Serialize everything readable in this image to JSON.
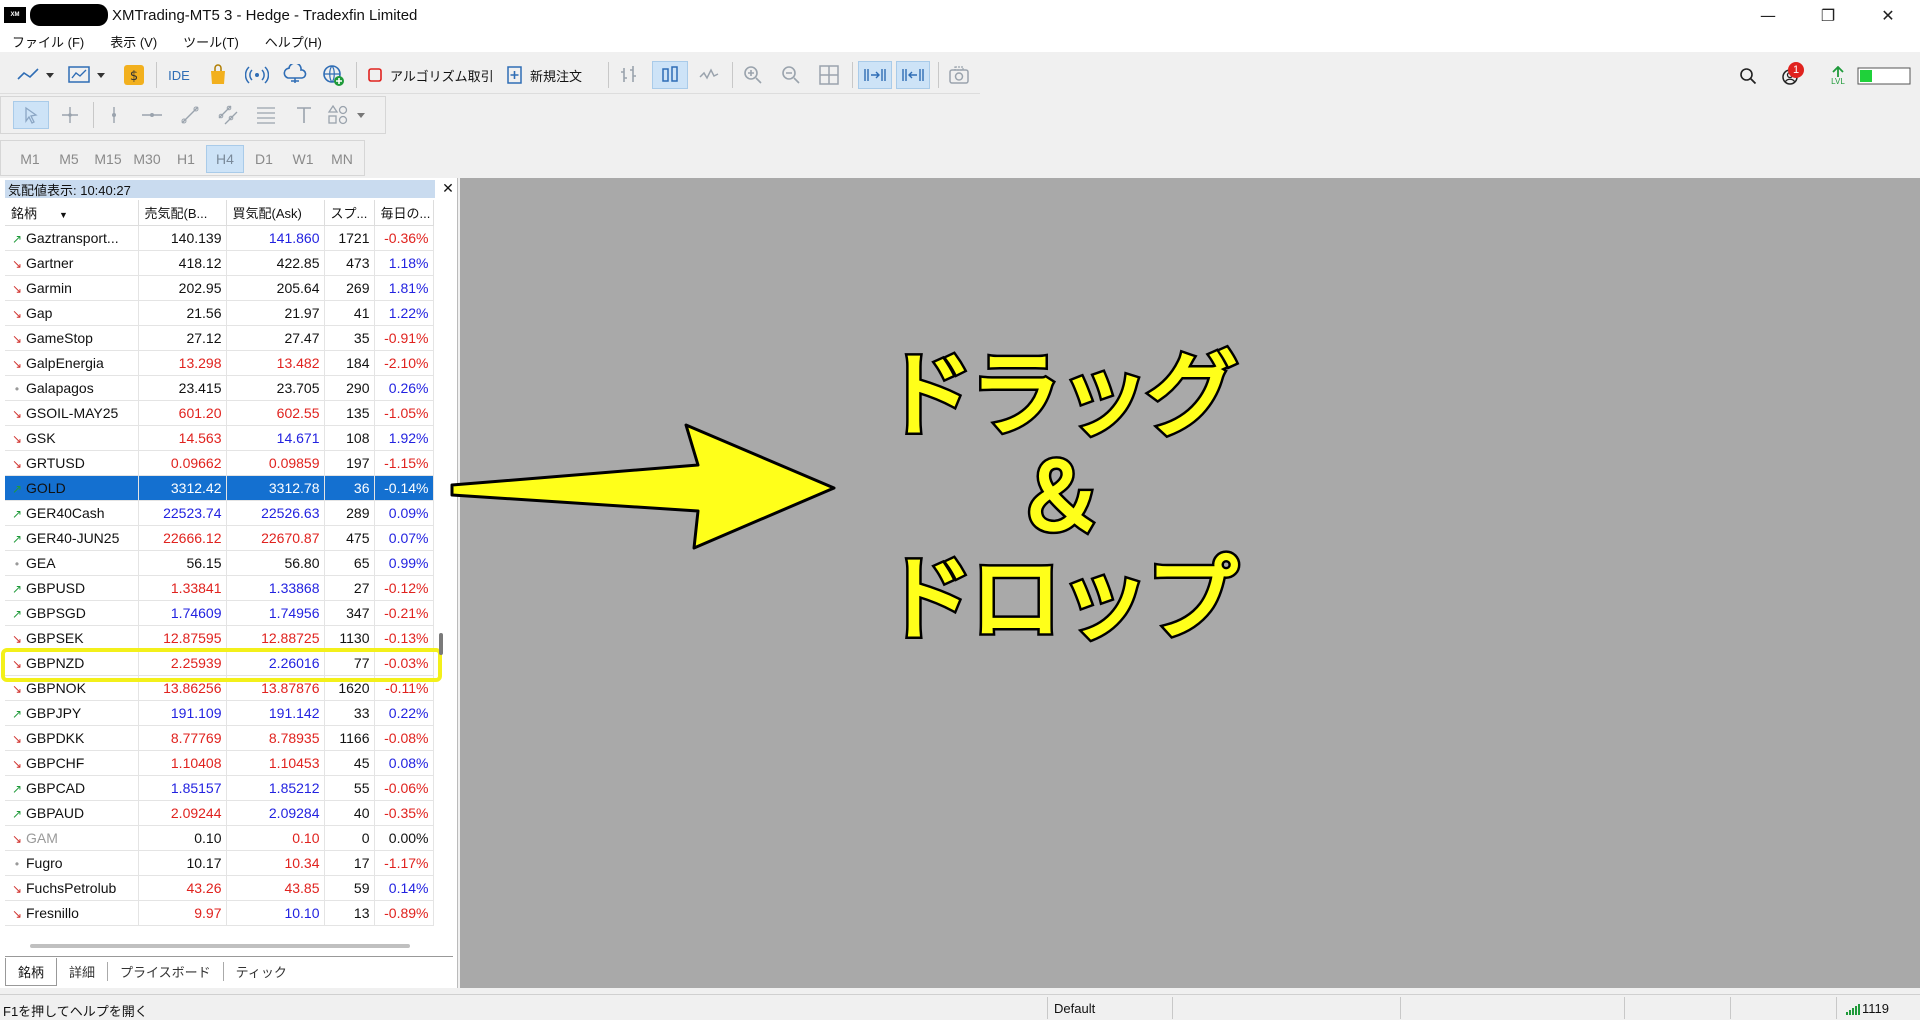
{
  "window": {
    "title": "XMTrading-MT5 3 - Hedge - Tradexfin Limited",
    "logo_text": "XM"
  },
  "menu": [
    "ファイル (F)",
    "表示 (V)",
    "ツール(T)",
    "ヘルプ(H)"
  ],
  "toolbar": {
    "ide_label": "IDE",
    "algo_label": "アルゴリズム取引",
    "new_order_label": "新規注文",
    "notification_count": "1",
    "level_label": "LVL"
  },
  "timeframes": [
    "M1",
    "M5",
    "M15",
    "M30",
    "H1",
    "H4",
    "D1",
    "W1",
    "MN"
  ],
  "active_timeframe": "H4",
  "market_watch": {
    "title": "気配値表示: 10:40:27",
    "columns": [
      "銘柄",
      "売気配(B...",
      "買気配(Ask)",
      "スプ...",
      "毎日の..."
    ],
    "rows": [
      {
        "symbol": "Gaztransport...",
        "dir": "up",
        "bid": "140.139",
        "ask": "141.860",
        "spread": "1721",
        "change": "-0.36%",
        "bid_color": "black",
        "ask_color": "blue",
        "change_color": "red"
      },
      {
        "symbol": "Gartner",
        "dir": "down",
        "bid": "418.12",
        "ask": "422.85",
        "spread": "473",
        "change": "1.18%",
        "bid_color": "black",
        "ask_color": "black",
        "change_color": "blue"
      },
      {
        "symbol": "Garmin",
        "dir": "down",
        "bid": "202.95",
        "ask": "205.64",
        "spread": "269",
        "change": "1.81%",
        "bid_color": "black",
        "ask_color": "black",
        "change_color": "blue"
      },
      {
        "symbol": "Gap",
        "dir": "down",
        "bid": "21.56",
        "ask": "21.97",
        "spread": "41",
        "change": "1.22%",
        "bid_color": "black",
        "ask_color": "black",
        "change_color": "blue"
      },
      {
        "symbol": "GameStop",
        "dir": "down",
        "bid": "27.12",
        "ask": "27.47",
        "spread": "35",
        "change": "-0.91%",
        "bid_color": "black",
        "ask_color": "black",
        "change_color": "red"
      },
      {
        "symbol": "GalpEnergia",
        "dir": "down",
        "bid": "13.298",
        "ask": "13.482",
        "spread": "184",
        "change": "-2.10%",
        "bid_color": "red",
        "ask_color": "red",
        "change_color": "red"
      },
      {
        "symbol": "Galapagos",
        "dir": "dot",
        "bid": "23.415",
        "ask": "23.705",
        "spread": "290",
        "change": "0.26%",
        "bid_color": "black",
        "ask_color": "black",
        "change_color": "blue"
      },
      {
        "symbol": "GSOIL-MAY25",
        "dir": "down",
        "bid": "601.20",
        "ask": "602.55",
        "spread": "135",
        "change": "-1.05%",
        "bid_color": "red",
        "ask_color": "red",
        "change_color": "red"
      },
      {
        "symbol": "GSK",
        "dir": "down",
        "bid": "14.563",
        "ask": "14.671",
        "spread": "108",
        "change": "1.92%",
        "bid_color": "red",
        "ask_color": "blue",
        "change_color": "blue"
      },
      {
        "symbol": "GRTUSD",
        "dir": "down",
        "bid": "0.09662",
        "ask": "0.09859",
        "spread": "197",
        "change": "-1.15%",
        "bid_color": "red",
        "ask_color": "red",
        "change_color": "red"
      },
      {
        "symbol": "GOLD",
        "dir": "up",
        "bid": "3312.42",
        "ask": "3312.78",
        "spread": "36",
        "change": "-0.14%",
        "bid_color": "black",
        "ask_color": "black",
        "change_color": "black",
        "selected": true
      },
      {
        "symbol": "GER40Cash",
        "dir": "up",
        "bid": "22523.74",
        "ask": "22526.63",
        "spread": "289",
        "change": "0.09%",
        "bid_color": "blue",
        "ask_color": "blue",
        "change_color": "blue"
      },
      {
        "symbol": "GER40-JUN25",
        "dir": "up",
        "bid": "22666.12",
        "ask": "22670.87",
        "spread": "475",
        "change": "0.07%",
        "bid_color": "red",
        "ask_color": "red",
        "change_color": "blue"
      },
      {
        "symbol": "GEA",
        "dir": "dot",
        "bid": "56.15",
        "ask": "56.80",
        "spread": "65",
        "change": "0.99%",
        "bid_color": "black",
        "ask_color": "black",
        "change_color": "blue"
      },
      {
        "symbol": "GBPUSD",
        "dir": "up",
        "bid": "1.33841",
        "ask": "1.33868",
        "spread": "27",
        "change": "-0.12%",
        "bid_color": "red",
        "ask_color": "blue",
        "change_color": "red"
      },
      {
        "symbol": "GBPSGD",
        "dir": "up",
        "bid": "1.74609",
        "ask": "1.74956",
        "spread": "347",
        "change": "-0.21%",
        "bid_color": "blue",
        "ask_color": "blue",
        "change_color": "red"
      },
      {
        "symbol": "GBPSEK",
        "dir": "down",
        "bid": "12.87595",
        "ask": "12.88725",
        "spread": "1130",
        "change": "-0.13%",
        "bid_color": "red",
        "ask_color": "red",
        "change_color": "red"
      },
      {
        "symbol": "GBPNZD",
        "dir": "down",
        "bid": "2.25939",
        "ask": "2.26016",
        "spread": "77",
        "change": "-0.03%",
        "bid_color": "red",
        "ask_color": "blue",
        "change_color": "red"
      },
      {
        "symbol": "GBPNOK",
        "dir": "down",
        "bid": "13.86256",
        "ask": "13.87876",
        "spread": "1620",
        "change": "-0.11%",
        "bid_color": "red",
        "ask_color": "red",
        "change_color": "red"
      },
      {
        "symbol": "GBPJPY",
        "dir": "up",
        "bid": "191.109",
        "ask": "191.142",
        "spread": "33",
        "change": "0.22%",
        "bid_color": "blue",
        "ask_color": "blue",
        "change_color": "blue"
      },
      {
        "symbol": "GBPDKK",
        "dir": "down",
        "bid": "8.77769",
        "ask": "8.78935",
        "spread": "1166",
        "change": "-0.08%",
        "bid_color": "red",
        "ask_color": "red",
        "change_color": "red"
      },
      {
        "symbol": "GBPCHF",
        "dir": "down",
        "bid": "1.10408",
        "ask": "1.10453",
        "spread": "45",
        "change": "0.08%",
        "bid_color": "red",
        "ask_color": "red",
        "change_color": "blue"
      },
      {
        "symbol": "GBPCAD",
        "dir": "up",
        "bid": "1.85157",
        "ask": "1.85212",
        "spread": "55",
        "change": "-0.06%",
        "bid_color": "blue",
        "ask_color": "blue",
        "change_color": "red"
      },
      {
        "symbol": "GBPAUD",
        "dir": "up",
        "bid": "2.09244",
        "ask": "2.09284",
        "spread": "40",
        "change": "-0.35%",
        "bid_color": "red",
        "ask_color": "blue",
        "change_color": "red"
      },
      {
        "symbol": "GAM",
        "dir": "down",
        "bid": "0.10",
        "ask": "0.10",
        "spread": "0",
        "change": "0.00%",
        "bid_color": "black",
        "ask_color": "red",
        "change_color": "black",
        "symbol_gray": true
      },
      {
        "symbol": "Fugro",
        "dir": "dot",
        "bid": "10.17",
        "ask": "10.34",
        "spread": "17",
        "change": "-1.17%",
        "bid_color": "black",
        "ask_color": "red",
        "change_color": "red"
      },
      {
        "symbol": "FuchsPetrolub",
        "dir": "down",
        "bid": "43.26",
        "ask": "43.85",
        "spread": "59",
        "change": "0.14%",
        "bid_color": "red",
        "ask_color": "red",
        "change_color": "blue"
      },
      {
        "symbol": "Fresnillo",
        "dir": "down",
        "bid": "9.97",
        "ask": "10.10",
        "spread": "13",
        "change": "-0.89%",
        "bid_color": "red",
        "ask_color": "blue",
        "change_color": "red"
      }
    ],
    "tabs": [
      "銘柄",
      "詳細",
      "プライスボード",
      "ティック"
    ]
  },
  "overlay": {
    "line1": "ドラッグ",
    "line2": "＆",
    "line3": "ドロップ"
  },
  "statusbar": {
    "help_text": "F1を押してヘルプを開く",
    "profile": "Default",
    "connection": "1119"
  },
  "colors": {
    "red": "#e0221e",
    "blue": "#2222e0",
    "selected_row": "#1470d0",
    "highlight": "#f3f01a",
    "chart_bg": "#a9a9a9"
  }
}
